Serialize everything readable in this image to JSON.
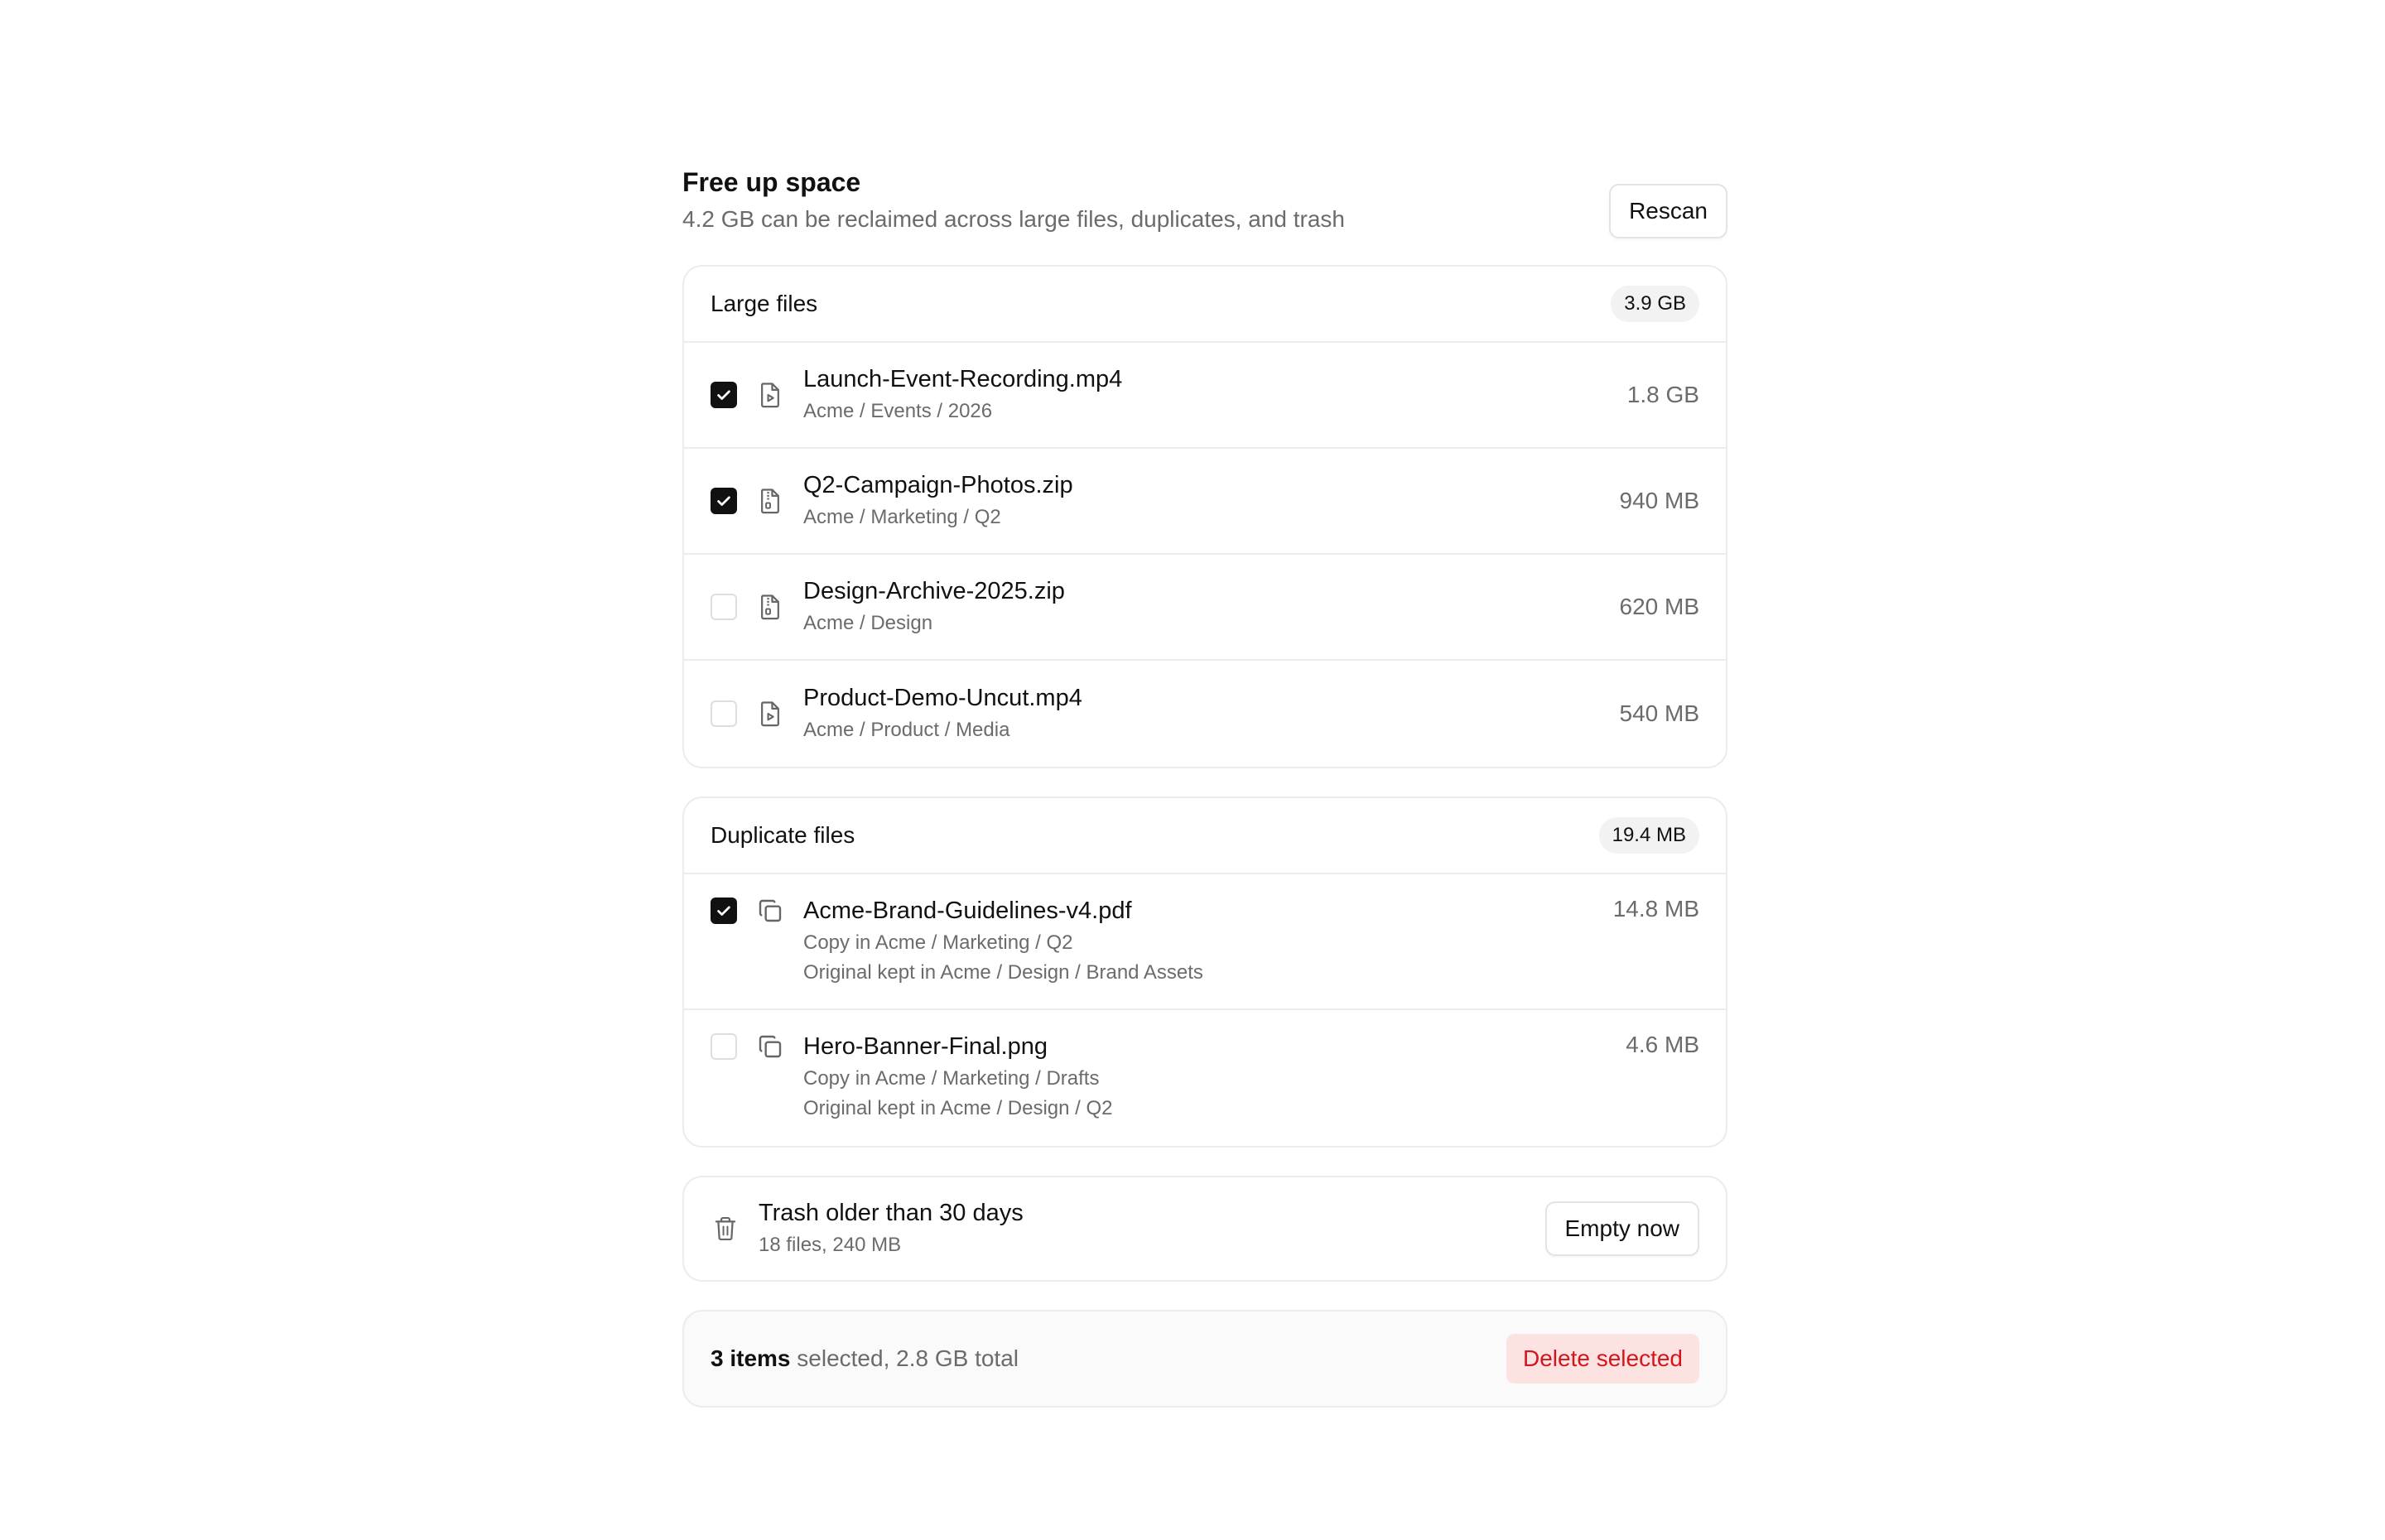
{
  "header": {
    "title": "Free up space",
    "subtitle": "4.2 GB can be reclaimed across large files, duplicates, and trash",
    "rescan_label": "Rescan"
  },
  "large_files": {
    "title": "Large files",
    "total": "3.9 GB",
    "items": [
      {
        "name": "Launch-Event-Recording.mp4",
        "path": "Acme / Events / 2026",
        "size": "1.8 GB",
        "checked": true,
        "icon": "video-file-icon"
      },
      {
        "name": "Q2-Campaign-Photos.zip",
        "path": "Acme / Marketing / Q2",
        "size": "940 MB",
        "checked": true,
        "icon": "archive-file-icon"
      },
      {
        "name": "Design-Archive-2025.zip",
        "path": "Acme / Design",
        "size": "620 MB",
        "checked": false,
        "icon": "archive-file-icon"
      },
      {
        "name": "Product-Demo-Uncut.mp4",
        "path": "Acme / Product / Media",
        "size": "540 MB",
        "checked": false,
        "icon": "video-file-icon"
      }
    ]
  },
  "duplicate_files": {
    "title": "Duplicate files",
    "total": "19.4 MB",
    "items": [
      {
        "name": "Acme-Brand-Guidelines-v4.pdf",
        "copy": "Copy in Acme / Marketing / Q2",
        "original": "Original kept in Acme / Design / Brand Assets",
        "size": "14.8 MB",
        "checked": true,
        "icon": "copy-icon"
      },
      {
        "name": "Hero-Banner-Final.png",
        "copy": "Copy in Acme / Marketing / Drafts",
        "original": "Original kept in Acme / Design / Q2",
        "size": "4.6 MB",
        "checked": false,
        "icon": "copy-icon"
      }
    ]
  },
  "trash": {
    "title": "Trash older than 30 days",
    "detail": "18 files, 240 MB",
    "button_label": "Empty now",
    "icon": "trash-icon"
  },
  "footer": {
    "count": "3 items",
    "summary": " selected, 2.8 GB total",
    "delete_label": "Delete selected"
  },
  "colors": {
    "accent_dark": "#111111",
    "danger": "#d2161e",
    "danger_bg": "#fde2e2"
  }
}
